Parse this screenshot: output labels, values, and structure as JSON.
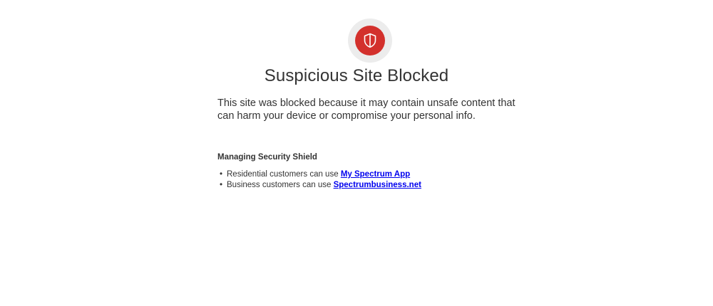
{
  "header": {
    "icon": "shield-icon",
    "title": "Suspicious Site Blocked",
    "accent_color": "#d3302c"
  },
  "main": {
    "description": "This site was blocked because it may contain unsafe content that can harm your device or compromise your personal info.",
    "section_heading": "Managing Security Shield",
    "items": [
      {
        "text": "Residential customers can use ",
        "link_label": "My Spectrum App"
      },
      {
        "text": "Business customers can use ",
        "link_label": "Spectrumbusiness.net"
      }
    ]
  }
}
